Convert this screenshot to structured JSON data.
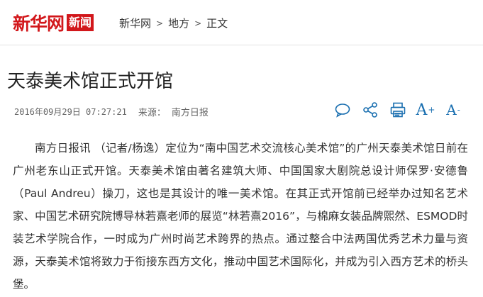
{
  "logo": {
    "main": "新华网",
    "box": "新闻"
  },
  "breadcrumb": {
    "items": [
      "新华网",
      "地方",
      "正文"
    ],
    "separator": ">"
  },
  "article": {
    "title": "天泰美术馆正式开馆",
    "datetime": "2016年09月29日 07:27:21",
    "source_label": "来源：",
    "source": "南方日报",
    "body": "南方日报讯 （记者/杨逸）定位为“南中国艺术交流核心美术馆”的广州天泰美术馆日前在广州老东山正式开馆。天泰美术馆由著名建筑大师、中国国家大剧院总设计师保罗·安德鲁（Paul Andreu）操刀，这也是其设计的唯一美术馆。在其正式开馆前已经举办过知名艺术家、中国艺术研究院博导林若熹老师的展览“林若熹2016”，与棉麻女装品牌熙然、ESMOD时装艺术学院合作，一时成为广州时尚艺术跨界的热点。通过整合中法两国优秀艺术力量与资源，天泰美术馆将致力于衔接东西方文化，推动中国艺术国际化，并成为引入西方艺术的桥头堡。"
  },
  "tools": {
    "icons": [
      "comment-icon",
      "share-icon",
      "print-icon",
      "font-increase-icon",
      "font-decrease-icon"
    ],
    "font_big": "A",
    "font_big_sup": "+",
    "font_small": "A",
    "font_small_sup": "-"
  },
  "colors": {
    "brand_red": "#d2171b",
    "tool_blue": "#1a6fb0"
  }
}
